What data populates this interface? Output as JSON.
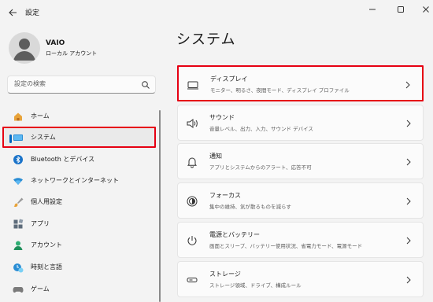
{
  "window": {
    "title": "設定"
  },
  "profile": {
    "name": "VAIO",
    "account_type": "ローカル アカウント"
  },
  "search": {
    "placeholder": "設定の検索"
  },
  "sidebar": {
    "items": [
      {
        "label": "ホーム",
        "icon": "home-icon"
      },
      {
        "label": "システム",
        "icon": "system-icon",
        "selected": true
      },
      {
        "label": "Bluetooth とデバイス",
        "icon": "bluetooth-icon"
      },
      {
        "label": "ネットワークとインターネット",
        "icon": "network-icon"
      },
      {
        "label": "個人用設定",
        "icon": "brush-icon"
      },
      {
        "label": "アプリ",
        "icon": "apps-icon"
      },
      {
        "label": "アカウント",
        "icon": "account-icon"
      },
      {
        "label": "時刻と言語",
        "icon": "time-language-icon"
      },
      {
        "label": "ゲーム",
        "icon": "game-icon"
      }
    ]
  },
  "main": {
    "title": "システム",
    "cards": [
      {
        "title": "ディスプレイ",
        "subtitle": "モニター、明るさ、夜間モード、ディスプレイ プロファイル",
        "icon": "display-icon",
        "highlighted": true
      },
      {
        "title": "サウンド",
        "subtitle": "音量レベル、出力、入力、サウンド デバイス",
        "icon": "sound-icon"
      },
      {
        "title": "通知",
        "subtitle": "アプリとシステムからのアラート、応答不可",
        "icon": "notification-icon"
      },
      {
        "title": "フォーカス",
        "subtitle": "集中の維持、気が散るものを減らす",
        "icon": "focus-icon"
      },
      {
        "title": "電源とバッテリー",
        "subtitle": "画面とスリープ、バッテリー使用状況、省電力モード、電源モード",
        "icon": "power-icon"
      },
      {
        "title": "ストレージ",
        "subtitle": "ストレージ領域、ドライブ、構成ルール",
        "icon": "storage-icon"
      }
    ]
  },
  "colors": {
    "accent": "#0067c0",
    "highlight_box": "#e60012",
    "background": "#f3f3f3",
    "card": "#fbfbfb"
  }
}
